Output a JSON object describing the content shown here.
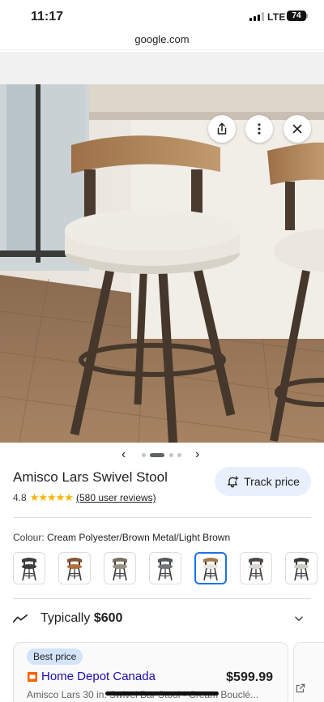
{
  "status_bar": {
    "time": "11:17",
    "network": "LTE",
    "battery": "74"
  },
  "browser": {
    "url": "google.com"
  },
  "image_actions": [
    {
      "icon": "share-icon"
    },
    {
      "icon": "more-vertical-icon"
    },
    {
      "icon": "close-icon"
    }
  ],
  "pager": {
    "prev": "‹",
    "next": "›",
    "count": 4,
    "active": 1
  },
  "product": {
    "title": "Amisco Lars Swivel Stool",
    "rating": "4.8",
    "stars": "★★★★★",
    "reviews": "(580 user reviews)",
    "track_price_label": "Track price"
  },
  "colour": {
    "label": "Colour:",
    "value": "Cream Polyester/Brown Metal/Light Brown",
    "selected_index": 4,
    "swatches": [
      {
        "seat": "#3d3d3d",
        "back": "#3d3d3d"
      },
      {
        "seat": "#b4703a",
        "back": "#8a5530"
      },
      {
        "seat": "#9a8f80",
        "back": "#7a6e60"
      },
      {
        "seat": "#6f7678",
        "back": "#55595b"
      },
      {
        "seat": "#e9e4da",
        "back": "#a7784a"
      },
      {
        "seat": "#d9d6cf",
        "back": "#4a4a4a"
      },
      {
        "seat": "#cfcac0",
        "back": "#3a3a3a"
      }
    ]
  },
  "typical": {
    "label": "Typically",
    "price": "$600"
  },
  "offer": {
    "badge": "Best price",
    "store": "Home Depot Canada",
    "price": "$599.99",
    "description": "Amisco Lars 30 in. Swivel Bar Stool - Cream Bouclé..."
  },
  "colors": {
    "accent": "#1a73e8",
    "chip_bg": "#e8f0fe",
    "badge_bg": "#d3e3fd",
    "star": "#f6b400",
    "link": "#1a0dab"
  }
}
